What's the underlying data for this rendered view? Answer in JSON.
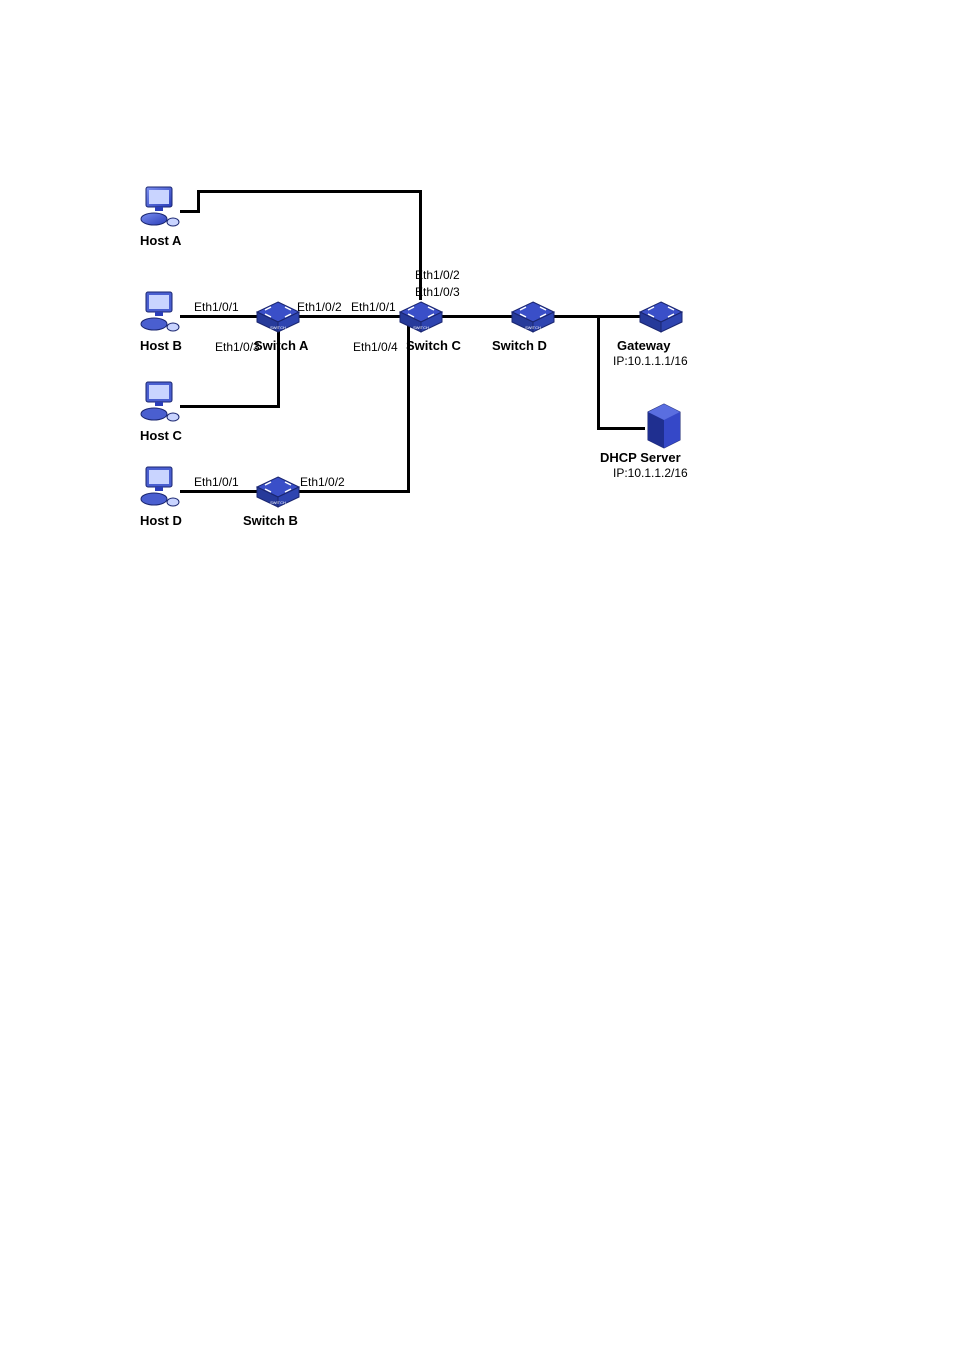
{
  "hosts": {
    "a": "Host A",
    "b": "Host B",
    "c": "Host C",
    "d": "Host D"
  },
  "switches": {
    "a": "Switch A",
    "b": "Switch B",
    "c": "Switch C",
    "d": "Switch D"
  },
  "gateway": {
    "label": "Gateway",
    "ip": "IP:10.1.1.1/16"
  },
  "dhcp": {
    "label": "DHCP Server",
    "ip": "IP:10.1.1.2/16"
  },
  "ports": {
    "swA_p1": "Eth1/0/1",
    "swA_p2": "Eth1/0/2",
    "swA_p3": "Eth1/0/3",
    "swC_p1": "Eth1/0/1",
    "swC_p2": "Eth1/0/2",
    "swC_p3": "Eth1/0/3",
    "swC_p4": "Eth1/0/4",
    "swB_p1": "Eth1/0/1",
    "swB_p2": "Eth1/0/2"
  }
}
